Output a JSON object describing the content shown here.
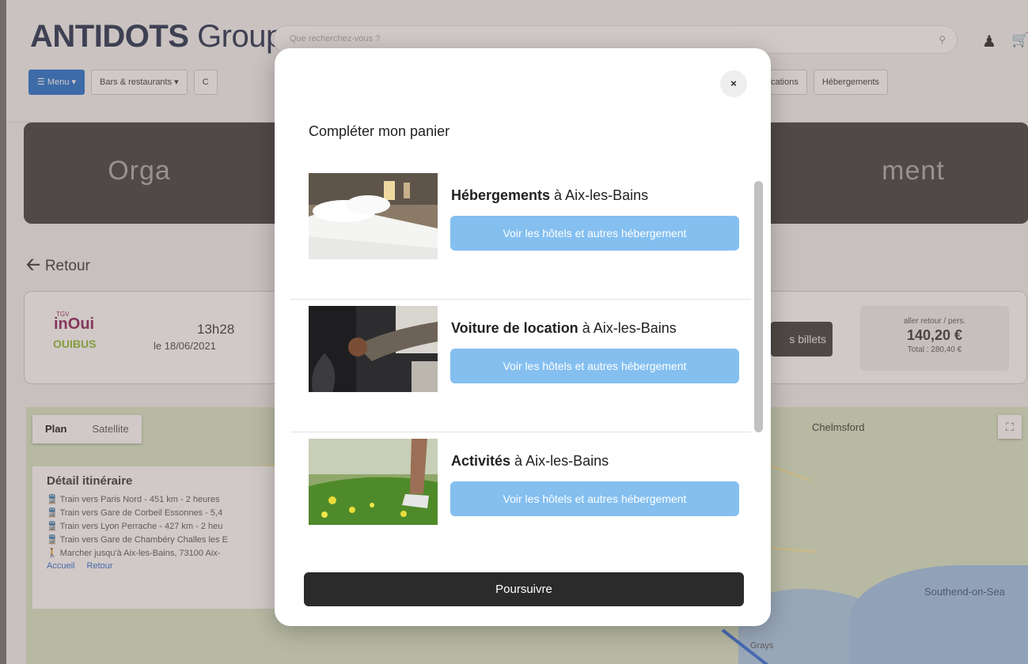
{
  "header": {
    "logo_bold": "ANTIDOTS",
    "logo_light": "Group",
    "search_placeholder": "Que recherchez-vous ?"
  },
  "nav": {
    "menu": "☰ Menu ▾",
    "bars": "Bars & restaurants ▾",
    "gifts": "C",
    "locations": "cations",
    "hebergements": "Hébergements"
  },
  "banner": {
    "title": "Orga                                                                                      ment"
  },
  "back_label": "Retour",
  "trip": {
    "brand_tgv": "TGV",
    "brand_inoui": "inOui",
    "brand_ouibus": "OUIBUS",
    "time": "13h28",
    "date": "le 18/06/2021",
    "tickets_button": "s billets",
    "price_label": "aller retour / pers.",
    "price": "140,20 €",
    "price_total": "Total : 280,40 €"
  },
  "map": {
    "tab_plan": "Plan",
    "tab_satellite": "Satellite",
    "itinerary_title": "Détail itinéraire",
    "itinerary_rows": [
      "Train vers Paris Nord - 451 km - 2 heures",
      "Train vers Gare de Corbeil Essonnes - 5,4",
      "Train vers Lyon Perrache - 427 km - 2 heu",
      "Train vers Gare de Chambéry Challes les E",
      "Marcher jusqu'à Aix-les-Bains, 73100 Aix-"
    ],
    "link_home": "Accueil",
    "link_back": "Retour",
    "label_chelmsford": "Chelmsford",
    "label_southend": "Southend-on-Sea",
    "label_grays": "Grays"
  },
  "modal": {
    "title": "Compléter mon panier",
    "close": "×",
    "items": [
      {
        "strong": "Hébergements",
        "rest": " à Aix-les-Bains",
        "button": "Voir les hôtels et autres hébergement"
      },
      {
        "strong": "Voiture de location",
        "rest": " à Aix-les-Bains",
        "button": "Voir les hôtels et autres hébergement"
      },
      {
        "strong": "Activités",
        "rest": " à Aix-les-Bains",
        "button": "Voir les hôtels et autres hébergement"
      }
    ],
    "proceed": "Poursuivre"
  },
  "colors": {
    "primary_blue": "#1e6fd0",
    "item_button": "#84bff0",
    "dark_button": "#2b2b2b",
    "banner": "#3b3b3b"
  }
}
